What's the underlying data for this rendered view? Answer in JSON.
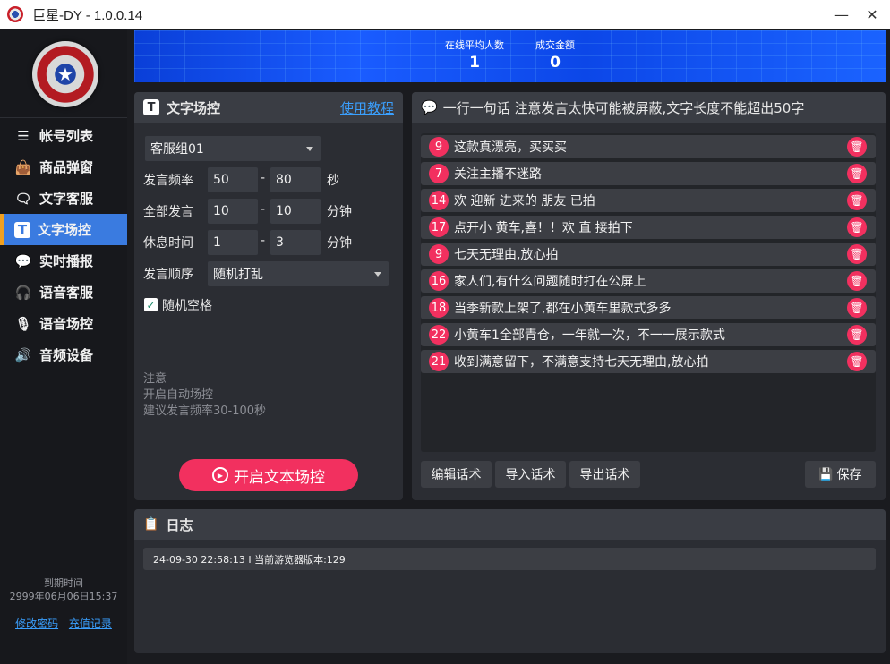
{
  "window": {
    "title": "巨星-DY - 1.0.0.14",
    "minimize": "—",
    "close": "✕"
  },
  "sidebar": {
    "items": [
      {
        "label": "帐号列表",
        "icon": "list-icon",
        "glyph": "☰"
      },
      {
        "label": "商品弹窗",
        "icon": "bag-icon",
        "glyph": "👜"
      },
      {
        "label": "文字客服",
        "icon": "chat-qa-icon",
        "glyph": "🗨"
      },
      {
        "label": "文字场控",
        "icon": "text-t-icon",
        "glyph": "T",
        "active": true
      },
      {
        "label": "实时播报",
        "icon": "wechat-icon",
        "glyph": "💬"
      },
      {
        "label": "语音客服",
        "icon": "headset-icon",
        "glyph": "🎧"
      },
      {
        "label": "语音场控",
        "icon": "microphone-icon",
        "glyph": "🎙"
      },
      {
        "label": "音频设备",
        "icon": "speaker-icon",
        "glyph": "🔊"
      }
    ],
    "expire_label": "到期时间",
    "expire_value": "2999年06月06日15:37",
    "link_password": "修改密码",
    "link_recharge": "充值记录"
  },
  "banner": {
    "online_label": "在线平均人数",
    "online_value": "1",
    "deal_label": "成交金额",
    "deal_value": "0"
  },
  "left_panel": {
    "title": "文字场控",
    "tutorial": "使用教程",
    "group": "客服组01",
    "freq_label": "发言频率",
    "freq_min": "50",
    "freq_max": "80",
    "freq_unit": "秒",
    "all_label": "全部发言",
    "all_min": "10",
    "all_max": "10",
    "all_unit": "分钟",
    "rest_label": "休息时间",
    "rest_min": "1",
    "rest_max": "3",
    "rest_unit": "分钟",
    "order_label": "发言顺序",
    "order_value": "随机打乱",
    "dash": "-",
    "random_space": "随机空格",
    "random_space_checked": true,
    "note1": "注意",
    "note2": "开启自动场控",
    "note3": "建议发言频率30-100秒",
    "start_button": "开启文本场控"
  },
  "right_panel": {
    "title": "一行一句话 注意发言太快可能被屏蔽,文字长度不能超出50字",
    "messages": [
      {
        "count": "9",
        "text": "这款真漂亮，买买买"
      },
      {
        "count": "7",
        "text": "关注主播不迷路"
      },
      {
        "count": "14",
        "text": "欢 迎新 进来的 朋友 已拍"
      },
      {
        "count": "17",
        "text": "点开小 黄车,喜！！欢 直 接拍下"
      },
      {
        "count": "9",
        "text": "七天无理由,放心拍"
      },
      {
        "count": "16",
        "text": "家人们,有什么问题随时打在公屏上"
      },
      {
        "count": "18",
        "text": "当季新款上架了,都在小黄车里款式多多"
      },
      {
        "count": "22",
        "text": "小黄车1全部青仓，一年就一次，不一一展示款式"
      },
      {
        "count": "21",
        "text": "收到满意留下，不满意支持七天无理由,放心拍"
      }
    ],
    "edit_button": "编辑话术",
    "import_button": "导入话术",
    "export_button": "导出话术",
    "save_button": "保存"
  },
  "log_panel": {
    "title": "日志",
    "lines": [
      "24-09-30 22:58:13 I  当前游览器版本:129"
    ]
  },
  "colors": {
    "accent": "#f2305f",
    "active_nav": "#3a7be0",
    "link": "#3aa0ff"
  }
}
